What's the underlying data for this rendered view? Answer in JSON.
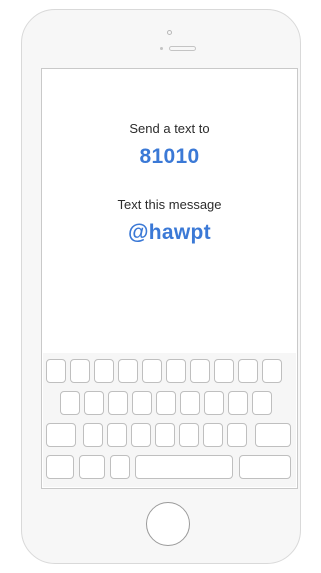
{
  "screen": {
    "send_label": "Send a text to",
    "number": "81010",
    "message_label": "Text this message",
    "message": "@hawpt"
  },
  "colors": {
    "accent": "#3b79d6",
    "text": "#2b2b2b",
    "frame": "#d9d9d9",
    "key_border": "#bfbfbf"
  },
  "keyboard": {
    "rows": [
      10,
      9,
      9,
      5
    ]
  },
  "icons": [
    "front-camera-icon",
    "speaker-icon",
    "home-button-icon"
  ]
}
